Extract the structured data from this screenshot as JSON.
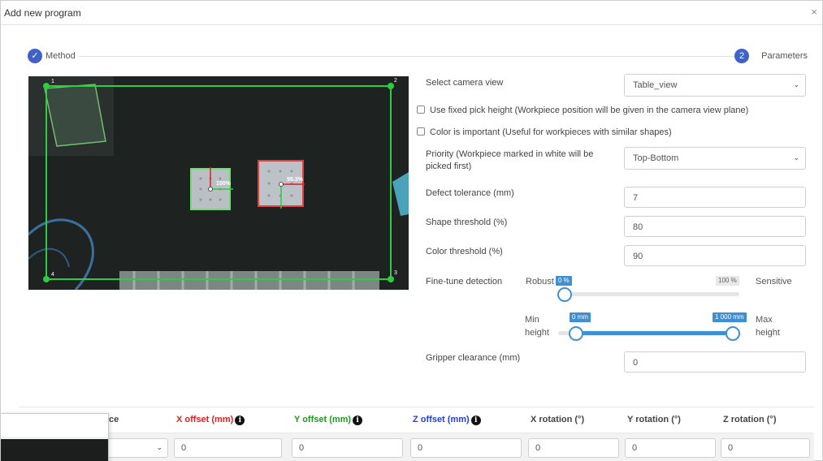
{
  "dialog": {
    "title": "Add new program",
    "close_glyph": "×"
  },
  "stepper": {
    "step1": {
      "label": "Method",
      "icon": "check-icon",
      "glyph": "✓"
    },
    "step2": {
      "label": "Parameters",
      "number": "2"
    }
  },
  "camera": {
    "corners": [
      "1",
      "2",
      "3",
      "4"
    ],
    "detections": [
      {
        "score": "100%"
      },
      {
        "score": "99.3%"
      }
    ]
  },
  "form": {
    "camera_view": {
      "label": "Select camera view",
      "value": "Table_view"
    },
    "fixed_pick_height": {
      "label": "Use fixed pick height (Workpiece position will be given in the camera view plane)",
      "checked": false
    },
    "color_important": {
      "label": "Color is important (Useful for workpieces with similar shapes)",
      "checked": false
    },
    "priority": {
      "label_line1": "Priority (Workpiece marked in white will be",
      "label_line2": "picked first)",
      "value": "Top-Bottom"
    },
    "defect_tolerance": {
      "label": "Defect tolerance (mm)",
      "value": "7"
    },
    "shape_threshold": {
      "label": "Shape threshold (%)",
      "value": "80"
    },
    "color_threshold": {
      "label": "Color threshold (%)",
      "value": "90"
    },
    "fine_tune": {
      "label": "Fine-tune detection",
      "left_label": "Robust",
      "right_label": "Sensitive",
      "value_tag": "0 %",
      "max_tag": "100 %",
      "value_fraction": 0
    },
    "height_range": {
      "min_line1": "Min",
      "min_line2": "height",
      "max_line1": "Max",
      "max_line2": "height",
      "min_tag": "0 mm",
      "max_tag": "1 000 mm",
      "min_fraction": 0.1,
      "max_fraction": 1
    },
    "gripper_clearance": {
      "label": "Gripper clearance (mm)",
      "value": "0"
    }
  },
  "table": {
    "headers": {
      "partial": "ce",
      "x_offset": "X offset (mm)",
      "y_offset": "Y offset (mm)",
      "z_offset": "Z offset (mm)",
      "x_rotation": "X rotation (°)",
      "y_rotation": "Y rotation (°)",
      "z_rotation": "Z rotation (°)"
    },
    "row": {
      "x_offset": "0",
      "y_offset": "0",
      "z_offset": "0",
      "x_rotation": "0",
      "y_rotation": "0",
      "z_rotation": "0"
    },
    "colors": {
      "x": "#e02020",
      "y": "#1e9a1e",
      "z": "#1f3fe0"
    }
  },
  "icons": {
    "info": "i",
    "chevron": "⌄"
  }
}
